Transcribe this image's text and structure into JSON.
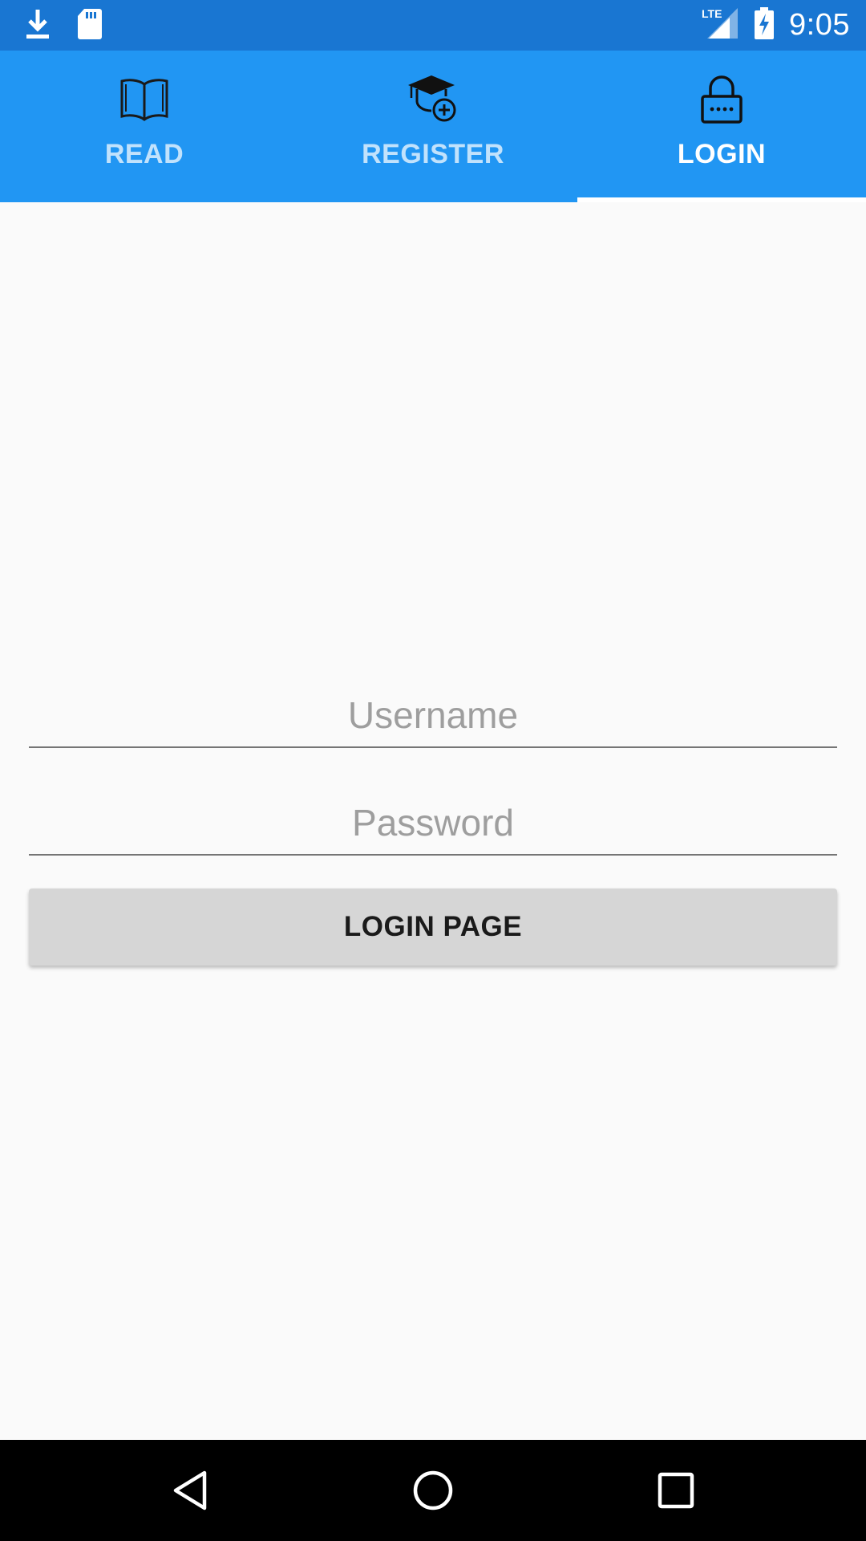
{
  "status_bar": {
    "time": "9:05",
    "left_icons": [
      "download-icon",
      "sd-card-icon"
    ],
    "right_icons": [
      "lte-signal-icon",
      "battery-charging-icon"
    ],
    "network_label": "LTE",
    "color": "#1976d2"
  },
  "tabs": [
    {
      "label": "READ",
      "icon": "book-icon",
      "active": false
    },
    {
      "label": "REGISTER",
      "icon": "graduation-cap-add-icon",
      "active": false
    },
    {
      "label": "LOGIN",
      "icon": "padlock-icon",
      "active": true
    }
  ],
  "form": {
    "username_placeholder": "Username",
    "username_value": "",
    "password_placeholder": "Password",
    "password_value": "",
    "button_label": "LOGIN PAGE"
  },
  "nav_bar": {
    "buttons": [
      "back-icon",
      "home-icon",
      "recents-icon"
    ]
  },
  "colors": {
    "tab_bar": "#2196f3",
    "status_bar": "#1976d2",
    "background": "#fafafa",
    "button": "#d6d6d6"
  }
}
